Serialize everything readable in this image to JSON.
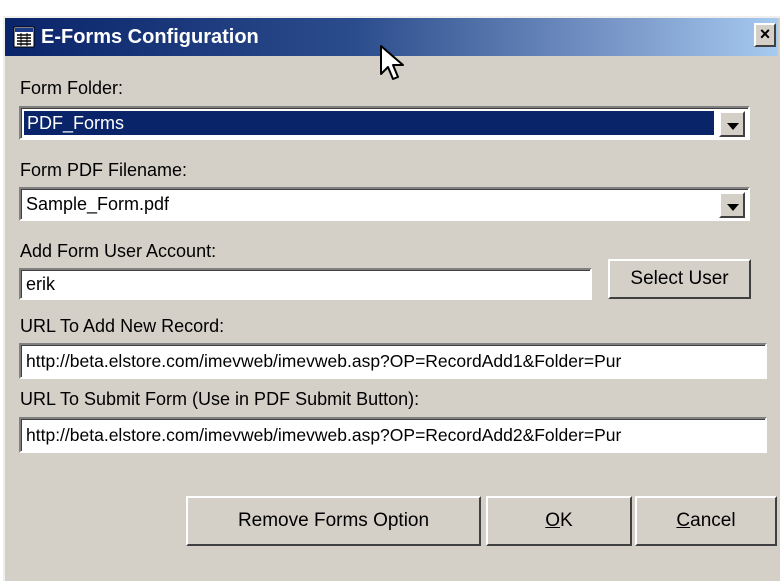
{
  "background": {
    "text": ""
  },
  "window": {
    "title": "E-Forms Configuration",
    "close_label": "×",
    "title_icon": "form-icon",
    "colors": {
      "titlebar": "#0a246a",
      "face": "#d4d0c8"
    }
  },
  "form": {
    "form_folder": {
      "label": "Form Folder:",
      "value": "PDF_Forms"
    },
    "form_pdf_filename": {
      "label": "Form PDF Filename:",
      "value": "Sample_Form.pdf"
    },
    "add_form_user_account": {
      "label": "Add Form User Account:",
      "value": "erik",
      "select_button": "Select User"
    },
    "url_add_new_record": {
      "label": "URL To Add New Record:",
      "value": "http://beta.elstore.com/imevweb/imevweb.asp?OP=RecordAdd1&Folder=Pur"
    },
    "url_submit_form": {
      "label": "URL To Submit Form (Use in PDF Submit Button):",
      "value": "http://beta.elstore.com/imevweb/imevweb.asp?OP=RecordAdd2&Folder=Pur"
    }
  },
  "buttons": {
    "remove_forms_option": "Remove Forms Option",
    "ok": {
      "accel": "O",
      "rest": "K"
    },
    "cancel": {
      "accel": "C",
      "rest": "ancel"
    }
  }
}
